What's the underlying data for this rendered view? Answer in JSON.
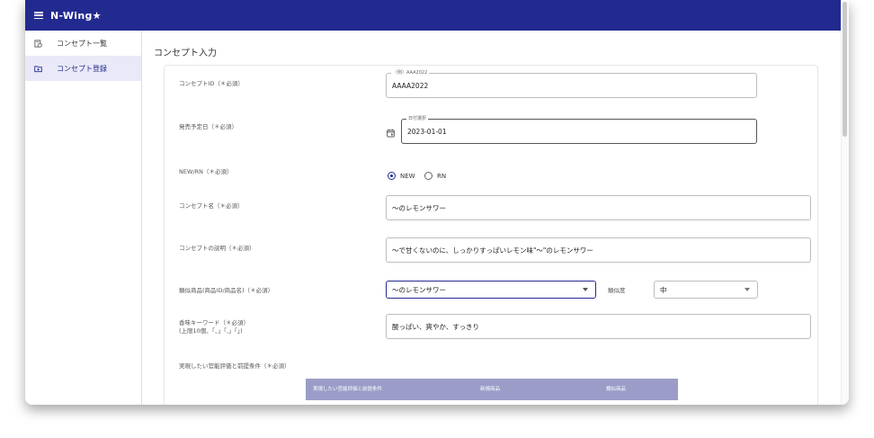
{
  "app": {
    "title": "N-Wing★"
  },
  "sidebar": {
    "items": [
      {
        "label": "コンセプト一覧",
        "icon": "list-clock-icon",
        "active": false
      },
      {
        "label": "コンセプト登録",
        "icon": "folder-add-icon",
        "active": true
      }
    ]
  },
  "page": {
    "title": "コンセプト入力"
  },
  "form": {
    "concept_id": {
      "label": "コンセプトID（＊必須）",
      "legend": "（例）AAA2022",
      "value": "AAAA2022"
    },
    "release_date": {
      "label": "発売予定日（＊必須）",
      "legend": "日付選択",
      "value": "2023-01-01"
    },
    "new_rn": {
      "label": "NEW/RN（＊必須）",
      "options": [
        "NEW",
        "RN"
      ],
      "selected": "NEW"
    },
    "concept_name": {
      "label": "コンセプト名（＊必須）",
      "value": "〜のレモンサワー"
    },
    "concept_desc": {
      "label": "コンセプトの説明（＊必須）",
      "value": "〜で甘くないのに、しっかりすっぱいレモン味\"〜\"のレモンサワー"
    },
    "similar_product": {
      "label": "類似商品(商品ID/商品名)（＊必須）",
      "value": "〜のレモンサワー"
    },
    "similarity": {
      "label": "類似度",
      "value": "中"
    },
    "flavor_keywords": {
      "label_line1": "香味キーワード（＊必須）",
      "label_line2": "(上限10個、「、」「,」「」)",
      "value": "酸っぱい、爽やか、すっきり"
    },
    "sensory_eval": {
      "label": "実現したい官能評価と前提条件（＊必須）"
    }
  },
  "table": {
    "headers": [
      "実現したい官能評価と前提条件",
      "新規商品",
      "類似商品"
    ]
  },
  "colors": {
    "appbar": "#232a8f",
    "table_header": "#9b9dc8",
    "active_item": "#e9e9f7"
  }
}
